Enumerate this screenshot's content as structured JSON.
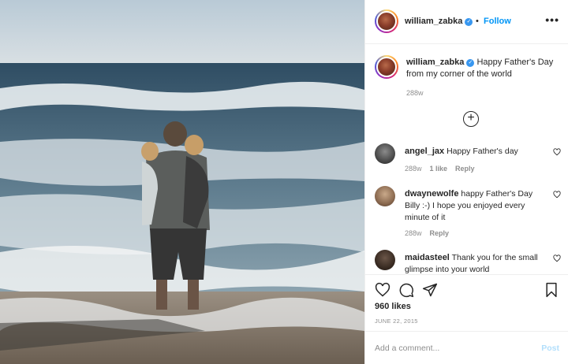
{
  "post": {
    "username": "william_zabka",
    "follow_label": "Follow",
    "separator": "•",
    "more_label": "•••",
    "verified_mark": "✓"
  },
  "caption": {
    "username": "william_zabka",
    "text": "Happy Father's Day from my corner of the world",
    "time": "288w"
  },
  "load_more_label": "+",
  "comments": [
    {
      "username": "angel_jax",
      "text": "Happy Father's day",
      "time": "288w",
      "likes": "1 like",
      "reply": "Reply"
    },
    {
      "username": "dwaynewolfe",
      "text": "happy Father's Day Billy :-) I hope you enjoyed every minute of it",
      "time": "288w",
      "reply": "Reply"
    },
    {
      "username": "maidasteel",
      "text": "Thank you for the small glimpse into your world"
    }
  ],
  "actions": {
    "likes_count": "960 likes",
    "date": "JUNE 22, 2015"
  },
  "add_comment": {
    "placeholder": "Add a comment...",
    "post_label": "Post"
  },
  "icons": [
    "heart-icon",
    "comment-icon",
    "share-icon",
    "bookmark-icon",
    "more-icon",
    "verified-icon",
    "plus-circle-icon"
  ],
  "colors": {
    "follow": "#0095f6",
    "post_disabled": "#b2dffc",
    "muted": "#8e8e8e",
    "verified": "#3897f0"
  }
}
